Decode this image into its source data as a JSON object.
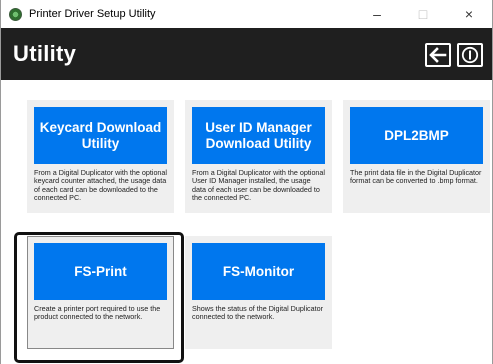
{
  "window": {
    "title": "Printer Driver Setup Utility",
    "controls": {
      "minimize": "–",
      "maximize": "□",
      "close": "×"
    }
  },
  "header": {
    "title": "Utility",
    "back_icon": "arrow-left-icon",
    "info_icon": "info-icon"
  },
  "cards": [
    {
      "title": "Keycard Download Utility",
      "description": "From a Digital Duplicator with the optional keycard counter attached, the usage data of each card can be downloaded to the connected PC."
    },
    {
      "title": "User ID Manager Download Utility",
      "description": "From a Digital Duplicator with the optional User ID Manager installed, the usage data of each user can be downloaded to the connected PC."
    },
    {
      "title": "DPL2BMP",
      "description": "The print data file in the Digital Duplicator format can be converted to .bmp format."
    },
    {
      "title": "FS-Print",
      "description": "Create a printer port required to use the product connected to the network."
    },
    {
      "title": "FS-Monitor",
      "description": "Shows the status of the Digital Duplicator connected to the network."
    }
  ],
  "colors": {
    "accent": "#0077ee",
    "header_bg": "#1f1f1f",
    "card_bg": "#efefef"
  }
}
